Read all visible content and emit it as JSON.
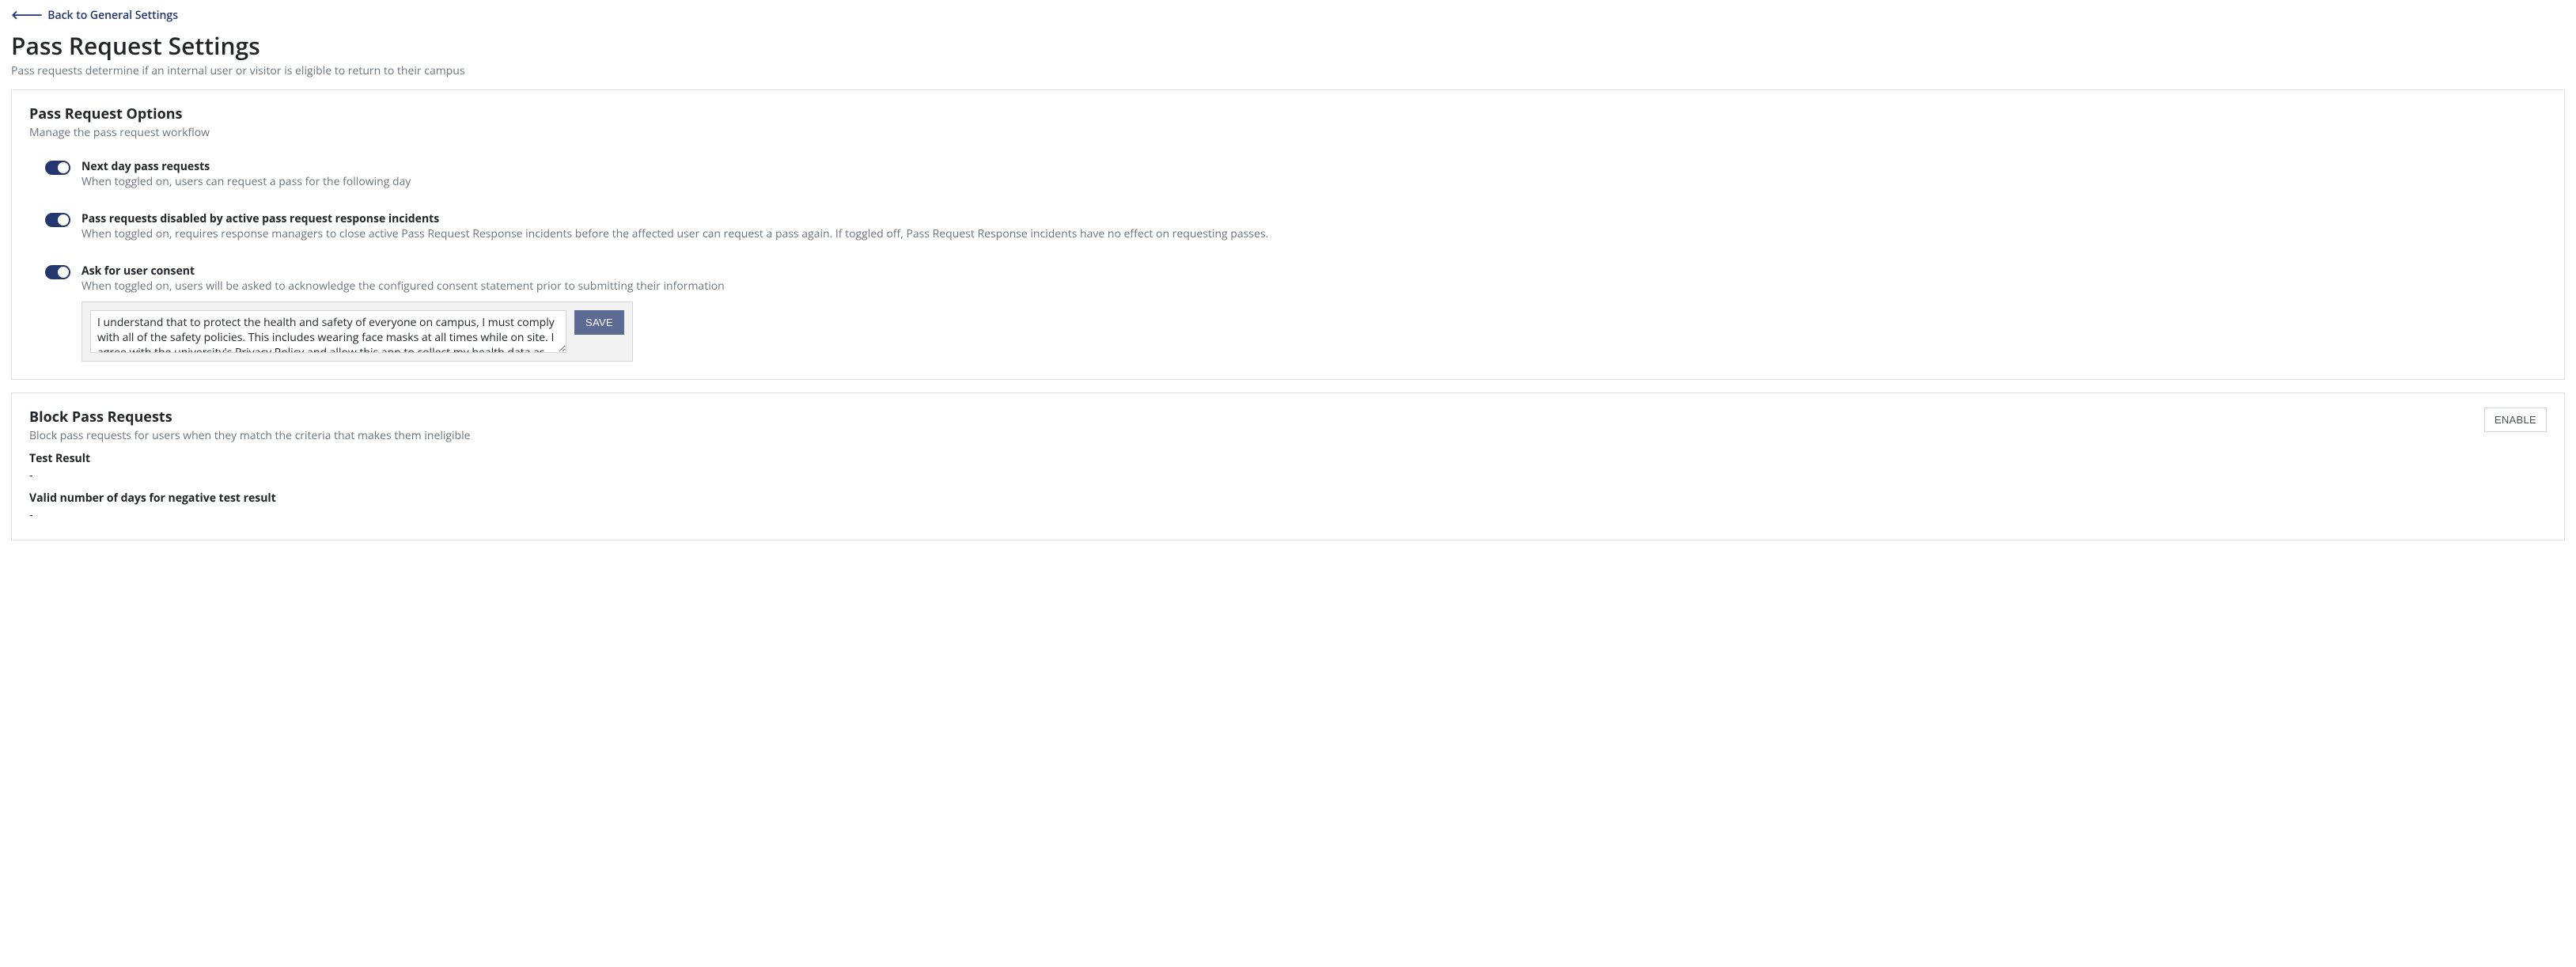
{
  "back_link": "Back to General Settings",
  "page_title": "Pass Request Settings",
  "page_subtitle": "Pass requests determine if an internal user or visitor is eligible to return to their campus",
  "options": {
    "title": "Pass Request Options",
    "subtitle": "Manage the pass request workflow",
    "toggles": [
      {
        "label": "Next day pass requests",
        "desc": "When toggled on, users can request a pass for the following day",
        "on": true
      },
      {
        "label": "Pass requests disabled by active pass request response incidents",
        "desc": "When toggled on, requires response managers to close active Pass Request Response incidents before the affected user can request a pass again. If toggled off, Pass Request Response incidents have no effect on requesting passes.",
        "on": true
      },
      {
        "label": "Ask for user consent",
        "desc": "When toggled on, users will be asked to acknowledge the configured consent statement prior to submitting their information",
        "on": true
      }
    ],
    "consent_text": "I understand that to protect the health and safety of everyone on campus, I must comply with all of the safety policies. This includes wearing face masks at all times while on site. I agree with the university's Privacy Policy and allow this app to collect my health data as specified in their terms and",
    "save_label": "SAVE"
  },
  "block": {
    "title": "Block Pass Requests",
    "subtitle": "Block pass requests for users when they match the criteria that makes them ineligible",
    "enable_label": "ENABLE",
    "fields": [
      {
        "label": "Test Result",
        "value": "-"
      },
      {
        "label": "Valid number of days for negative test result",
        "value": "-"
      }
    ]
  }
}
